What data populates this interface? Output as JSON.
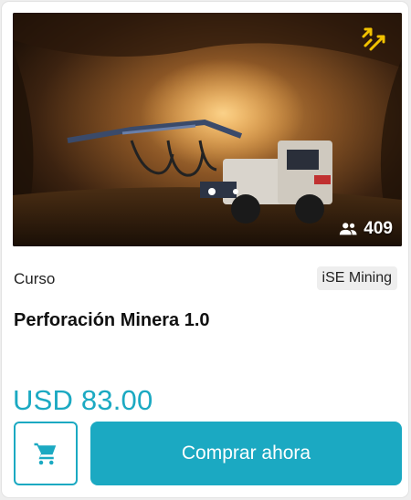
{
  "card": {
    "enrollment_count": "409",
    "course_type": "Curso",
    "provider": "iSE Mining",
    "title": "Perforación Minera 1.0",
    "price": "USD 83.00",
    "buy_label": "Comprar ahora"
  },
  "icons": {
    "corner": "expand-arrows-icon",
    "students": "people-icon",
    "cart": "shopping-cart-icon"
  },
  "colors": {
    "accent": "#1ba9c2",
    "corner_icon": "#f2c200"
  }
}
